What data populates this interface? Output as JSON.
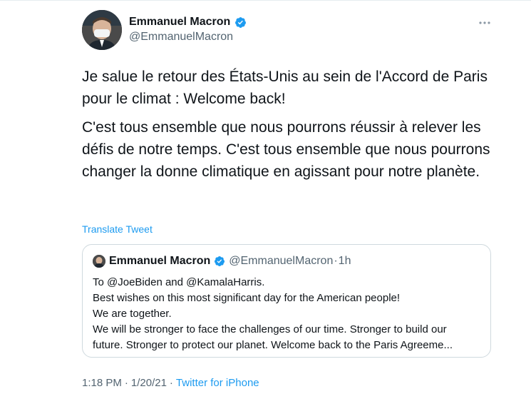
{
  "tweet": {
    "author": {
      "display_name": "Emmanuel Macron",
      "handle": "@EmmanuelMacron",
      "verified_icon": "verified-badge-icon",
      "avatar_icon": "profile-avatar"
    },
    "more_icon": "more-options-icon",
    "paragraphs": [
      "Je salue le retour des États-Unis au sein de l'Accord de Paris pour le climat : Welcome back!",
      "C'est tous ensemble que nous pourrons réussir à relever les défis de notre temps. C'est tous ensemble que nous pourrons changer la donne climatique en agissant pour notre planète."
    ],
    "translate_label": "Translate Tweet",
    "quoted": {
      "display_name": "Emmanuel Macron",
      "handle": "@EmmanuelMacron",
      "separator": "·",
      "time": "1h",
      "lines": [
        "To @JoeBiden and @KamalaHarris.",
        "Best wishes on this most significant day for the American people!",
        "We are together.",
        "We will be stronger to face the challenges of our time. Stronger to build our",
        "future. Stronger to protect our planet. Welcome back to the Paris Agreeme..."
      ]
    },
    "meta": {
      "time": "1:18 PM",
      "separator1": "·",
      "date": "1/20/21",
      "separator2": "·",
      "source": "Twitter for iPhone"
    }
  },
  "colors": {
    "accent": "#1d9bf0",
    "text_primary": "#0f1419",
    "text_secondary": "#536471",
    "border": "#cfd9de"
  }
}
